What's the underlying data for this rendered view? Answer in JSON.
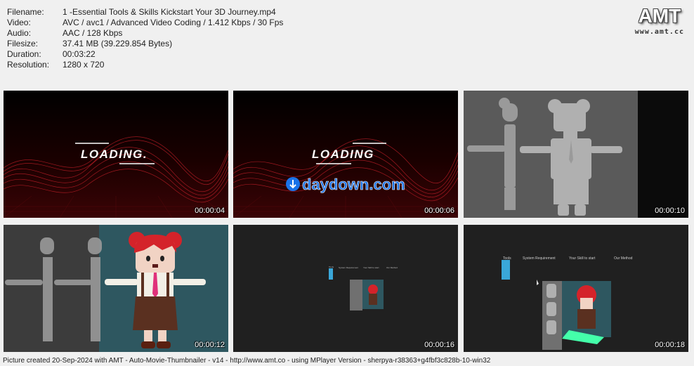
{
  "info": [
    {
      "key": "Filename:",
      "value": "1 -Essential Tools & Skills Kickstart Your 3D Journey.mp4"
    },
    {
      "key": "Video:",
      "value": "AVC / avc1 / Advanced Video Coding / 1.412 Kbps / 30 Fps"
    },
    {
      "key": "Audio:",
      "value": "AAC / 128 Kbps"
    },
    {
      "key": "Filesize:",
      "value": "37.41 MB (39.229.854 Bytes)"
    },
    {
      "key": "Duration:",
      "value": "00:03:22"
    },
    {
      "key": "Resolution:",
      "value": "1280 x 720"
    }
  ],
  "logo": {
    "main": "AMT",
    "sub": "www.amt.cc"
  },
  "thumbs": [
    {
      "time": "00:00:04",
      "loading": "LOADING."
    },
    {
      "time": "00:00:06",
      "loading": "LOADING",
      "brand": "daydown.com"
    },
    {
      "time": "00:00:10"
    },
    {
      "time": "00:00:12"
    },
    {
      "time": "00:00:16",
      "menu": [
        "Tools",
        "System Requirement",
        "Your Skill to start",
        "Our Method"
      ]
    },
    {
      "time": "00:00:18",
      "menu": [
        "Tools",
        "System Requirement",
        "Your Skill to start",
        "Our Method"
      ]
    }
  ],
  "footer": "Picture created 20-Sep-2024 with AMT - Auto-Movie-Thumbnailer - v14 - http://www.amt.co - using MPlayer Version - sherpya-r38363+g4fbf3c828b-10-win32",
  "colors": {
    "loading_wave": "#c8202a",
    "brand_blue": "#1a73e8",
    "gray_bg": "#5a5a5a",
    "teal_bg": "#2e5760",
    "dark_ui": "#202020"
  }
}
